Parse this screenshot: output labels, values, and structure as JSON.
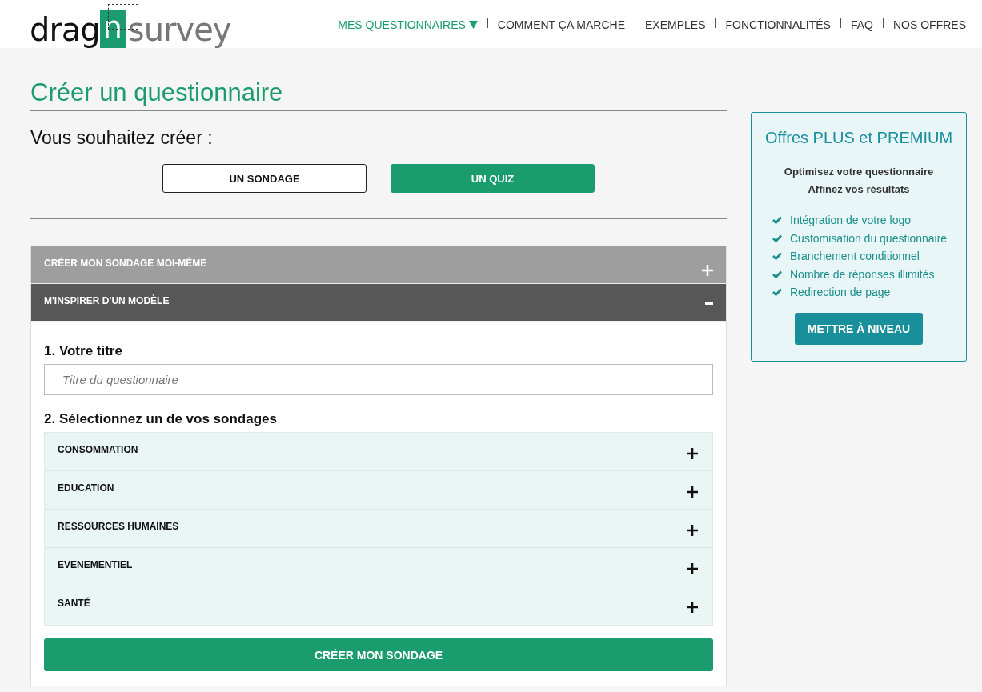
{
  "logo": {
    "part_1": "drag",
    "part_2": "n",
    "part_3": "survey"
  },
  "nav": [
    {
      "label": "MES QUESTIONNAIRES",
      "selected": true,
      "dropdown": true
    },
    {
      "label": "COMMENT ÇA MARCHE",
      "selected": false,
      "dropdown": false
    },
    {
      "label": "EXEMPLES",
      "selected": false,
      "dropdown": false
    },
    {
      "label": "FONCTIONNALITÉS",
      "selected": false,
      "dropdown": false
    },
    {
      "label": "FAQ",
      "selected": false,
      "dropdown": false
    },
    {
      "label": "NOS OFFRES",
      "selected": false,
      "dropdown": false
    }
  ],
  "page_title": "Créer un questionnaire",
  "question": "Vous souhaitez créer :",
  "type_choices": [
    {
      "label": "UN SONDAGE",
      "selected": false
    },
    {
      "label": "UN QUIZ",
      "selected": true
    }
  ],
  "panels": [
    {
      "title": "CRÉER MON SONDAGE MOI-MÊME",
      "expanded": false
    },
    {
      "title": "M'INSPIRER D'UN MODÈLE",
      "expanded": true
    }
  ],
  "form": {
    "title_label": "1. Votre titre",
    "title_field": {
      "placeholder": "Titre du questionnaire"
    },
    "select_label": "2. Sélectionnez un de vos sondages",
    "categories": [
      {
        "label": "CONSOMMATION",
        "expanded": false
      },
      {
        "label": "EDUCATION",
        "expanded": false
      },
      {
        "label": "RESSOURCES HUMAINES",
        "expanded": false
      },
      {
        "label": "EVENEMENTIEL",
        "expanded": false
      },
      {
        "label": "SANTÉ",
        "expanded": false
      }
    ],
    "submit": "CRÉER MON SONDAGE"
  },
  "offer": {
    "title": "Offres PLUS et PREMIUM",
    "subtitle_1": "Optimisez votre questionnaire",
    "subtitle_2": "Affinez vos résultats",
    "features": [
      "Intégration de votre logo",
      "Customisation du questionnaire",
      "Branchement conditionnel",
      "Nombre de réponses illimités",
      "Redirection de page"
    ],
    "button": "METTRE À NIVEAU"
  }
}
